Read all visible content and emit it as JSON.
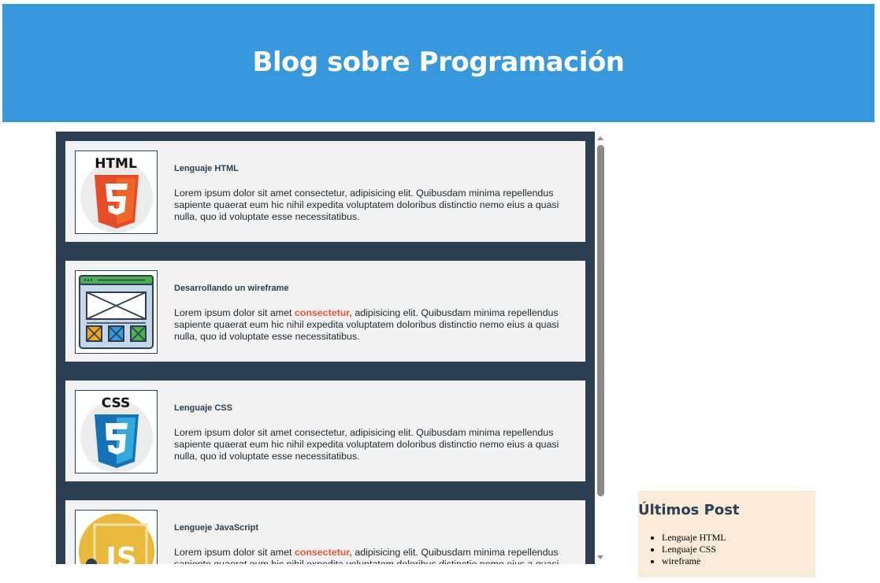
{
  "header": {
    "title": "Blog sobre Programación"
  },
  "posts": [
    {
      "title": "Lenguaje HTML",
      "body_before": "Lorem ipsum dolor sit amet consectetur, adipisicing elit. Quibusdam minima repellendus sapiente quaerat eum hic nihil expedita voluptatem doloribus distinctio nemo eius a quasi nulla, quo id voluptate esse necessitatibus.",
      "highlight": "",
      "body_after": "",
      "icon": "html5-logo-icon",
      "icon_text": "HTML"
    },
    {
      "title": "Desarrollando un wireframe",
      "body_before": "Lorem ipsum dolor sit amet ",
      "highlight": "consectetur,",
      "body_after": " adipisicing elit. Quibusdam minima repellendus sapiente quaerat eum hic nihil expedita voluptatem doloribus distinctio nemo eius a quasi nulla, quo id voluptate esse necessitatibus.",
      "icon": "wireframe-icon",
      "icon_text": ""
    },
    {
      "title": "Lenguaje CSS",
      "body_before": "Lorem ipsum dolor sit amet consectetur, adipisicing elit. Quibusdam minima repellendus sapiente quaerat eum hic nihil expedita voluptatem doloribus distinctio nemo eius a quasi nulla, quo id voluptate esse necessitatibus.",
      "highlight": "",
      "body_after": "",
      "icon": "css3-logo-icon",
      "icon_text": "CSS"
    },
    {
      "title": "Lengueje JavaScript",
      "body_before": "Lorem ipsum dolor sit amet ",
      "highlight": "consectetur,",
      "body_after": " adipisicing elit. Quibusdam minima repellendus sapiente quaerat eum hic nihil expedita voluptatem doloribus distinctio nemo eius a quasi nulla, quo id voluptate esse necessitatibus.",
      "icon": "javascript-logo-icon",
      "icon_text": "JS"
    }
  ],
  "sidebar": {
    "title": "Últimos Post",
    "items": [
      "Lenguaje HTML",
      "Lenguaje CSS",
      "wireframe"
    ]
  },
  "colors": {
    "header_bg": "#3798db",
    "feed_bg": "#2c3e50",
    "card_bg": "#f2f2f2",
    "highlight": "#e8573c",
    "sidebar_bg": "#f9ebd9"
  }
}
